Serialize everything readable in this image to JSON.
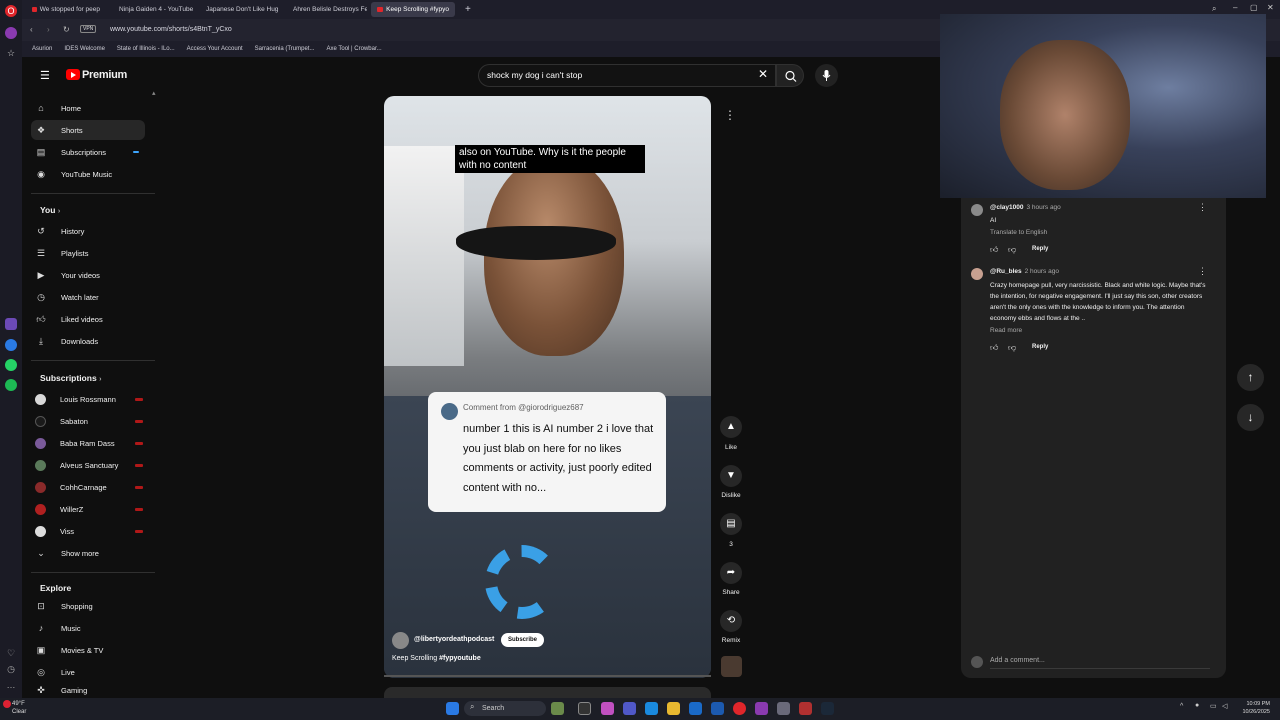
{
  "browser": {
    "tabs": [
      {
        "label": "We stopped for peep"
      },
      {
        "label": "Ninja Gaiden 4 - YouTube"
      },
      {
        "label": "Japanese Don't Like Hug"
      },
      {
        "label": "Ahren Belisle Destroys Fe"
      },
      {
        "label": "Keep Scrolling #fypyo"
      }
    ],
    "url": "www.youtube.com/shorts/s4BtnT_yCxo",
    "vpn": "VPN",
    "bookmarks": [
      "Asurion",
      "IDES Welcome",
      "State of Illinois - ILo...",
      "Access Your Account",
      "Sarracenia (Trumpet...",
      "Axe Tool | Crowbar..."
    ]
  },
  "header": {
    "logo": "Premium",
    "search_value": "shock my dog i can't stop"
  },
  "sidebar": {
    "main": [
      {
        "label": "Home",
        "icon": "home-icon"
      },
      {
        "label": "Shorts",
        "icon": "shorts-icon"
      },
      {
        "label": "Subscriptions",
        "icon": "subscriptions-icon"
      },
      {
        "label": "YouTube Music",
        "icon": "music-icon"
      }
    ],
    "you_heading": "You",
    "you": [
      {
        "label": "History"
      },
      {
        "label": "Playlists"
      },
      {
        "label": "Your videos"
      },
      {
        "label": "Watch later"
      },
      {
        "label": "Liked videos"
      },
      {
        "label": "Downloads"
      }
    ],
    "subs_heading": "Subscriptions",
    "subs": [
      {
        "label": "Louis Rossmann",
        "color": "#d8d8d8"
      },
      {
        "label": "Sabaton",
        "color": "#1a1a1a"
      },
      {
        "label": "Baba Ram Dass",
        "color": "#7a5a9a"
      },
      {
        "label": "Alveus Sanctuary",
        "color": "#5a7a5a"
      },
      {
        "label": "CohhCarnage",
        "color": "#8a2a2a"
      },
      {
        "label": "WillerZ",
        "color": "#b02020"
      },
      {
        "label": "Viss",
        "color": "#dddddd"
      }
    ],
    "show_more": "Show more",
    "explore_heading": "Explore",
    "explore": [
      {
        "label": "Shopping"
      },
      {
        "label": "Music"
      },
      {
        "label": "Movies & TV"
      },
      {
        "label": "Live"
      },
      {
        "label": "Gaming"
      }
    ]
  },
  "video": {
    "caption": "also on YouTube. Why is it the people with no content",
    "comment_from": "Comment from @giorodriguez687",
    "comment_body": "number 1 this is AI number 2 i love that you just blab on here for no likes comments or activity, just poorly edited content with no...",
    "channel": "@libertyordeathpodcast",
    "subscribe": "Subscribe",
    "title_prefix": "Keep Scrolling",
    "title_tag": "#fypyoutube"
  },
  "actions": {
    "like": "Like",
    "dislike": "Dislike",
    "comments": "3",
    "share": "Share",
    "remix": "Remix"
  },
  "comments": [
    {
      "user": "@clay1000",
      "time": "3 hours ago",
      "text": "AI",
      "translate": "Translate to English",
      "reply": "Reply"
    },
    {
      "user": "@Ru_bles",
      "time": "2 hours ago",
      "text": "Crazy homepage pull, very narcissistic. Black and white logic. Maybe that's the intention, for negative engagement. I'll just say this son, other creators aren't the only ones with the knowledge to inform you. The attention economy ebbs and flows at the ..",
      "read_more": "Read more",
      "reply": "Reply"
    }
  ],
  "add_comment_placeholder": "Add a comment...",
  "taskbar": {
    "weather_temp": "49°F",
    "weather_desc": "Clear",
    "search": "Search",
    "time": "10:09 PM",
    "date": "10/26/2025"
  }
}
